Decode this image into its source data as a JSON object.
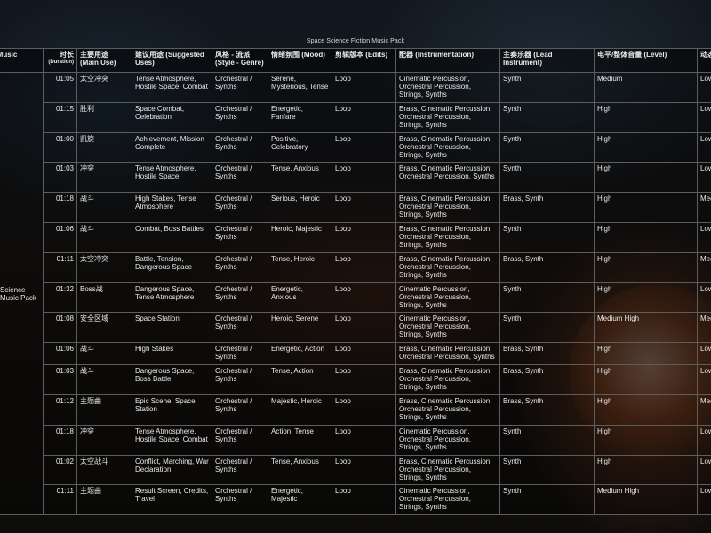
{
  "title": "Space Science Fiction Music Pack",
  "headers": {
    "pack": "(Music",
    "duration": "时长",
    "duration_sub": "(Duration)",
    "use": "主要用途 (Main Use)",
    "suggested": "建议用途 (Suggested Uses)",
    "style": "风格 - 流派 (Style - Genre)",
    "mood": "情绪氛围 (Mood)",
    "edits": "剪辑版本 (Edits)",
    "instrumentation": "配器 (Instrumentation)",
    "lead": "主奏乐器 (Lead Instrument)",
    "level": "电平/整体音量 (Level)",
    "extra": "动态"
  },
  "pack_name_line1": "Science",
  "pack_name_line2": "Music Pack",
  "rows": [
    {
      "time": "01:05",
      "use": "太空冲突",
      "suggested": "Tense Atmosphere, Hostile Space, Combat",
      "style": "Orchestral / Synths",
      "mood": "Serene, Mysterious, Tense",
      "edits": "Loop",
      "instr": "Cinematic Percussion, Orchestral Percussion, Strings, Synths",
      "lead": "Synth",
      "level": "Medium",
      "extra": "Low"
    },
    {
      "time": "01:15",
      "use": "胜利",
      "suggested": "Space Combat, Celebration",
      "style": "Orchestral / Synths",
      "mood": "Energetic, Fanfare",
      "edits": "Loop",
      "instr": "Brass, Cinematic Percussion, Orchestral Percussion, Strings, Synths",
      "lead": "Synth",
      "level": "High",
      "extra": "Low"
    },
    {
      "time": "01:00",
      "use": "凯旋",
      "suggested": "Achievement, Mission Complete",
      "style": "Orchestral / Synths",
      "mood": "Positive, Celebratory",
      "edits": "Loop",
      "instr": "Brass, Cinematic Percussion, Orchestral Percussion, Strings, Synths",
      "lead": "Synth",
      "level": "High",
      "extra": "Low"
    },
    {
      "time": "01:03",
      "use": "冲突",
      "suggested": "Tense Atmosphere, Hostile Space",
      "style": "Orchestral / Synths",
      "mood": "Tense, Anxious",
      "edits": "Loop",
      "instr": "Brass, Cinematic Percussion, Orchestral Percussion, Synths",
      "lead": "Synth",
      "level": "High",
      "extra": "Low"
    },
    {
      "time": "01:18",
      "use": "战斗",
      "suggested": "High Stakes, Tense Atmosphere",
      "style": "Orchestral / Synths",
      "mood": "Serious, Heroic",
      "edits": "Loop",
      "instr": "Brass, Cinematic Percussion, Orchestral Percussion, Strings, Synths",
      "lead": "Brass, Synth",
      "level": "High",
      "extra": "Med"
    },
    {
      "time": "01:06",
      "use": "战斗",
      "suggested": "Combat, Boss Battles",
      "style": "Orchestral / Synths",
      "mood": "Heroic, Majestic",
      "edits": "Loop",
      "instr": "Brass, Cinematic Percussion, Orchestral Percussion, Strings, Synths",
      "lead": "Synth",
      "level": "High",
      "extra": "Low"
    },
    {
      "time": "01:11",
      "use": "太空冲突",
      "suggested": "Battle, Tension, Dangerous Space",
      "style": "Orchestral / Synths",
      "mood": "Tense, Heroic",
      "edits": "Loop",
      "instr": "Brass, Cinematic Percussion, Orchestral Percussion, Strings, Synths",
      "lead": "Brass, Synth",
      "level": "High",
      "extra": "Med"
    },
    {
      "time": "01:32",
      "use": "Boss战",
      "suggested": "Dangerous Space, Tense Atmosphere",
      "style": "Orchestral / Synths",
      "mood": "Energetic, Anxious",
      "edits": "Loop",
      "instr": "Cinematic Percussion, Orchestral Percussion, Strings, Synths",
      "lead": "Synth",
      "level": "High",
      "extra": "Low"
    },
    {
      "time": "01:08",
      "use": "安全区域",
      "suggested": "Space Station",
      "style": "Orchestral / Synths",
      "mood": "Heroic, Serene",
      "edits": "Loop",
      "instr": "Cinematic Percussion, Orchestral Percussion, Strings, Synths",
      "lead": "Synth",
      "level": "Medium High",
      "extra": "Med"
    },
    {
      "time": "01:06",
      "use": "战斗",
      "suggested": "High Stakes",
      "style": "Orchestral / Synths",
      "mood": "Energetic, Action",
      "edits": "Loop",
      "instr": "Brass, Cinematic Percussion, Orchestral Percussion, Synths",
      "lead": "Brass, Synth",
      "level": "High",
      "extra": "Low",
      "short": true
    },
    {
      "time": "01:03",
      "use": "战斗",
      "suggested": "Dangerous Space, Boss Battle",
      "style": "Orchestral / Synths",
      "mood": "Tense, Action",
      "edits": "Loop",
      "instr": "Brass, Cinematic Percussion, Orchestral Percussion, Strings, Synths",
      "lead": "Brass, Synth",
      "level": "High",
      "extra": "Low"
    },
    {
      "time": "01:12",
      "use": "主题曲",
      "suggested": "Epic Scene, Space Station",
      "style": "Orchestral / Synths",
      "mood": "Majestic, Heroic",
      "edits": "Loop",
      "instr": "Brass, Cinematic Percussion, Orchestral Percussion, Strings, Synths",
      "lead": "Brass, Synth",
      "level": "High",
      "extra": "Med"
    },
    {
      "time": "01:18",
      "use": "冲突",
      "suggested": "Tense Atmosphere, Hostile Space, Combat",
      "style": "Orchestral / Synths",
      "mood": "Action, Tense",
      "edits": "Loop",
      "instr": "Cinematic Percussion, Orchestral Percussion, Strings, Synths",
      "lead": "Synth",
      "level": "High",
      "extra": "Low"
    },
    {
      "time": "01:02",
      "use": "太空战斗",
      "suggested": "Conflict, Marching, War Declaration",
      "style": "Orchestral / Synths",
      "mood": "Tense, Anxious",
      "edits": "Loop",
      "instr": "Brass, Cinematic Percussion, Orchestral Percussion, Strings, Synths",
      "lead": "Synth",
      "level": "High",
      "extra": "Low"
    },
    {
      "time": "01:11",
      "use": "主题曲",
      "suggested": "Result Screen, Credits, Travel",
      "style": "Orchestral / Synths",
      "mood": "Energetic, Majestic",
      "edits": "Loop",
      "instr": "Cinematic Percussion, Orchestral Percussion, Strings, Synths",
      "lead": "Synth",
      "level": "Medium High",
      "extra": "Low"
    }
  ]
}
